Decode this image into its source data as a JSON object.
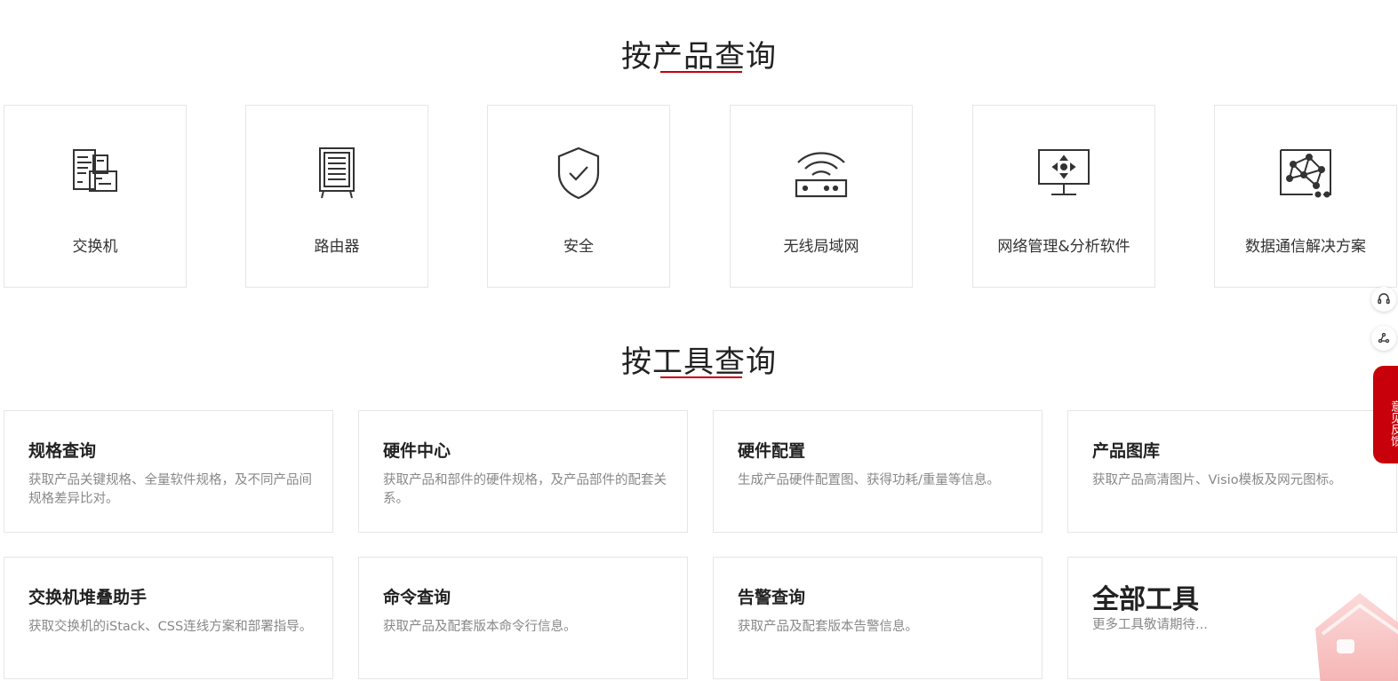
{
  "product_section": {
    "title": "按产品查询",
    "items": [
      {
        "label": "交换机",
        "icon": "switch-icon"
      },
      {
        "label": "路由器",
        "icon": "router-icon"
      },
      {
        "label": "安全",
        "icon": "security-shield-icon"
      },
      {
        "label": "无线局域网",
        "icon": "wifi-router-icon"
      },
      {
        "label": "网络管理&分析软件",
        "icon": "monitor-network-icon"
      },
      {
        "label": "数据通信解决方案",
        "icon": "network-topology-icon"
      }
    ]
  },
  "tool_section": {
    "title": "按工具查询",
    "items": [
      {
        "title": "规格查询",
        "desc": "获取产品关键规格、全量软件规格，及不同产品间规格差异比对。"
      },
      {
        "title": "硬件中心",
        "desc": "获取产品和部件的硬件规格，及产品部件的配套关系。"
      },
      {
        "title": "硬件配置",
        "desc": "生成产品硬件配置图、获得功耗/重量等信息。"
      },
      {
        "title": "产品图库",
        "desc": "获取产品高清图片、Visio模板及网元图标。"
      },
      {
        "title": "交换机堆叠助手",
        "desc": "获取交换机的iStack、CSS连线方案和部署指导。"
      },
      {
        "title": "命令查询",
        "desc": "获取产品及配套版本命令行信息。"
      },
      {
        "title": "告警查询",
        "desc": "获取产品及配套版本告警信息。"
      },
      {
        "title": "全部工具",
        "desc": "更多工具敬请期待..."
      }
    ]
  },
  "side_toolbar": {
    "feedback_label": "意见反馈",
    "icons": [
      "headset-icon",
      "share-icon",
      "home-icon"
    ]
  },
  "colors": {
    "accent": "#c7000b",
    "border": "#e6e6e6",
    "desc_text": "#888888"
  }
}
